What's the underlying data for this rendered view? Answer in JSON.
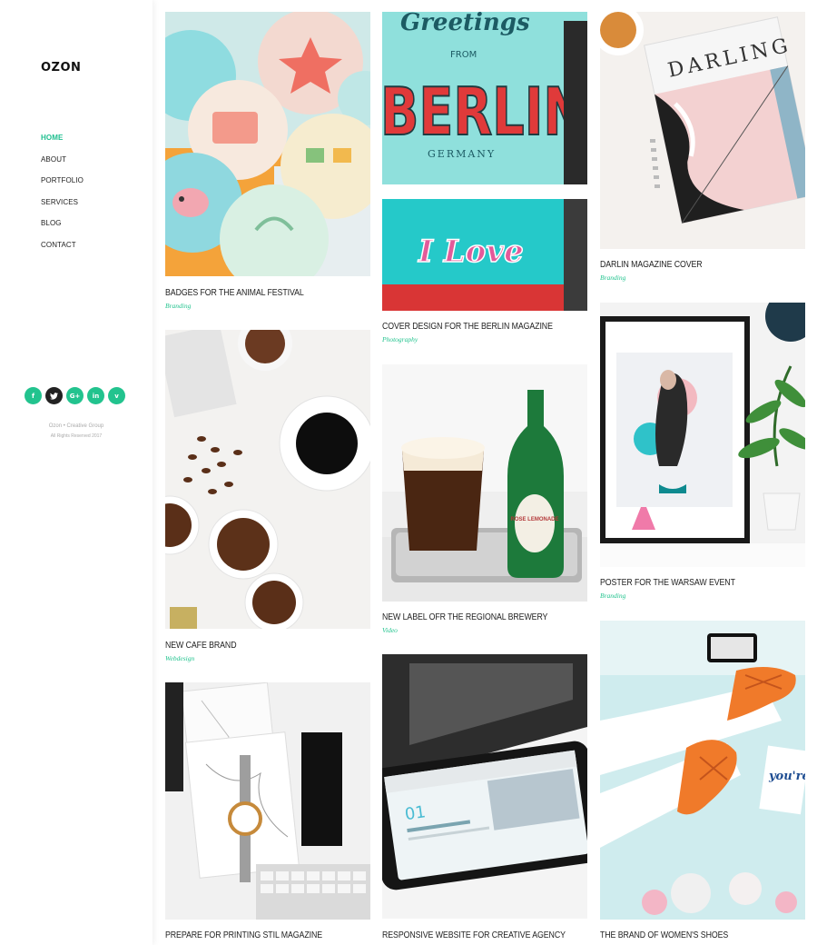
{
  "brand": {
    "logo": "OZON"
  },
  "nav": {
    "items": [
      {
        "label": "HOME",
        "active": true
      },
      {
        "label": "ABOUT"
      },
      {
        "label": "PORTFOLIO"
      },
      {
        "label": "SERVICES"
      },
      {
        "label": "BLOG"
      },
      {
        "label": "CONTACT"
      }
    ]
  },
  "social": [
    {
      "glyph": "f",
      "icon": "facebook-icon"
    },
    {
      "glyph": "t",
      "icon": "twitter-icon"
    },
    {
      "glyph": "G+",
      "icon": "google-plus-icon"
    },
    {
      "glyph": "in",
      "icon": "linkedin-icon"
    },
    {
      "glyph": "v",
      "icon": "vimeo-icon"
    }
  ],
  "footer": {
    "line1": "Ozon  •  Creative Group",
    "line2": "All Rights Reserved 2017"
  },
  "portfolio": [
    {
      "title": "BADGES FOR THE ANIMAL FESTIVAL",
      "category": "Branding",
      "image": "badges-photo"
    },
    {
      "title": "NEW CAFE BRAND",
      "category": "Webdesign",
      "image": "coffee-photo"
    },
    {
      "title": "PREPARE FOR PRINTING STIL MAGAZINE",
      "category": "",
      "image": "watch-magazine-photo"
    },
    {
      "title": "COVER DESIGN FOR THE BERLIN MAGAZINE",
      "category": "Photography",
      "image": "berlin-photo"
    },
    {
      "title": "NEW LABEL OFR THE REGIONAL BREWERY",
      "category": "Video",
      "image": "brewery-photo"
    },
    {
      "title": "RESPONSIVE WEBSITE FOR CREATIVE AGENCY",
      "category": "",
      "image": "phone-photo"
    },
    {
      "title": "DARLIN MAGAZINE COVER",
      "category": "Branding",
      "image": "darlin-magazine-photo"
    },
    {
      "title": "POSTER FOR THE WARSAW EVENT",
      "category": "Branding",
      "image": "poster-photo"
    },
    {
      "title": "THE BRAND OF WOMEN'S SHOES",
      "category": "",
      "image": "shoes-photo"
    }
  ],
  "image_text": {
    "berlin_top": "BERLIN",
    "berlin_greetings": "Greetings",
    "berlin_from": "FROM",
    "berlin_germany": "GERMANY",
    "berlin_love": "I Love",
    "darlin": "DARLING",
    "shoes_sign": "you're dope",
    "bottle_label": "ROSE LEMONADE"
  },
  "colors": {
    "accent": "#22c38e",
    "text": "#222222"
  }
}
